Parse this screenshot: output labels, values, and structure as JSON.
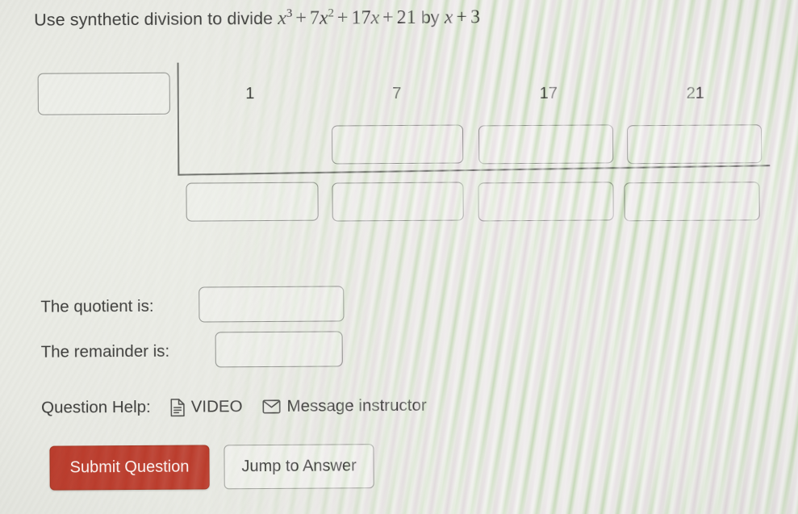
{
  "prompt": {
    "lead": "Use synthetic division to divide",
    "dividend": {
      "t1_base": "x",
      "t1_exp": "3",
      "op1": "+",
      "t2_coef": "7",
      "t2_base": "x",
      "t2_exp": "2",
      "op2": "+",
      "t3_coef": "17",
      "t3_base": "x",
      "op3": "+",
      "t4_const": "21"
    },
    "by": "by",
    "divisor": {
      "base": "x",
      "op": "+",
      "const": "3"
    }
  },
  "synthetic_division": {
    "divisor_box": {
      "value": "",
      "placeholder": ""
    },
    "coefficients": [
      "1",
      "7",
      "17",
      "21"
    ],
    "middle_row": [
      {
        "value": "",
        "placeholder": ""
      },
      {
        "value": "",
        "placeholder": ""
      },
      {
        "value": "",
        "placeholder": ""
      }
    ],
    "bottom_row": [
      {
        "value": "",
        "placeholder": ""
      },
      {
        "value": "",
        "placeholder": ""
      },
      {
        "value": "",
        "placeholder": ""
      },
      {
        "value": "",
        "placeholder": ""
      }
    ]
  },
  "answers": {
    "quotient_label": "The quotient is:",
    "quotient_value": "",
    "remainder_label": "The remainder is:",
    "remainder_value": ""
  },
  "help": {
    "label": "Question Help:",
    "video_label": "VIDEO",
    "video_icon": "document-icon",
    "message_label": "Message instructor",
    "message_icon": "envelope-icon"
  },
  "buttons": {
    "submit_label": "Submit Question",
    "jump_label": "Jump to Answer"
  },
  "colors": {
    "submit_button": "#bf3c2c",
    "submit_button_text": "#fdf5f3",
    "text": "#3b3b39",
    "box_border": "#8d8f8a",
    "bracket": "#6f716c",
    "background": "#e9eae4"
  }
}
